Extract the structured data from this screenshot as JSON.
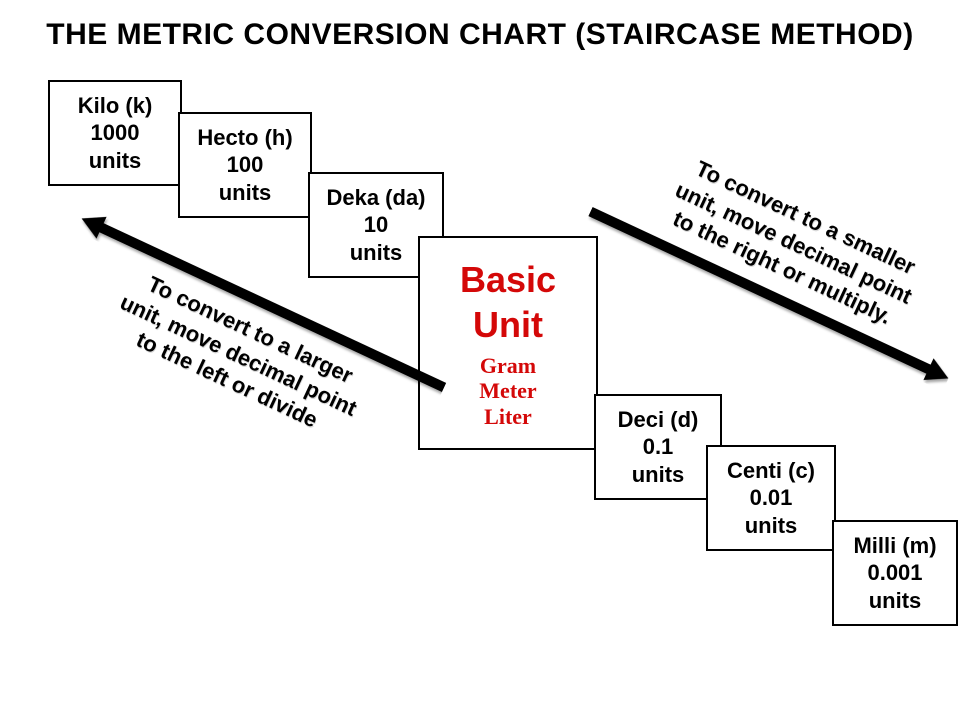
{
  "title": "THE METRIC CONVERSION CHART (STAIRCASE METHOD)",
  "steps": {
    "kilo": {
      "label": "Kilo (k)",
      "value": "1000",
      "units": "units"
    },
    "hecto": {
      "label": "Hecto (h)",
      "value": "100",
      "units": "units"
    },
    "deka": {
      "label": "Deka (da)",
      "value": "10",
      "units": "units"
    },
    "basic": {
      "l1": "Basic",
      "l2": "Unit",
      "s1": "Gram",
      "s2": "Meter",
      "s3": "Liter"
    },
    "deci": {
      "label": "Deci (d)",
      "value": "0.1",
      "units": "units"
    },
    "centi": {
      "label": "Centi (c)",
      "value": "0.01",
      "units": "units"
    },
    "milli": {
      "label": "Milli (m)",
      "value": "0.001",
      "units": "units"
    }
  },
  "arrows": {
    "up": {
      "l1": "To convert to a larger",
      "l2": "unit, move decimal point",
      "l3": "to the left or divide"
    },
    "down": {
      "l1": "To convert to a smaller",
      "l2": "unit, move decimal point",
      "l3": "to the right or multiply."
    }
  }
}
